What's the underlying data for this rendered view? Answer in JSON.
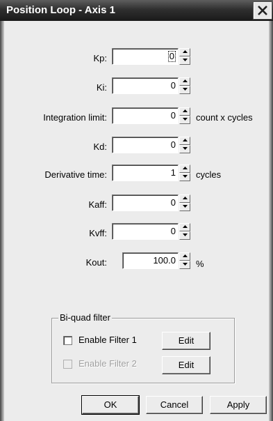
{
  "window": {
    "title": "Position Loop - Axis 1"
  },
  "fields": [
    {
      "label": "Kp:",
      "value": "0",
      "unit": ""
    },
    {
      "label": "Ki:",
      "value": "0",
      "unit": ""
    },
    {
      "label": "Integration limit:",
      "value": "0",
      "unit": "count x cycles"
    },
    {
      "label": "Kd:",
      "value": "0",
      "unit": ""
    },
    {
      "label": "Derivative time:",
      "value": "1",
      "unit": "cycles"
    },
    {
      "label": "Kaff:",
      "value": "0",
      "unit": ""
    },
    {
      "label": "Kvff:",
      "value": "0",
      "unit": ""
    },
    {
      "label": "Kout:",
      "value": "100.0",
      "unit": "%"
    }
  ],
  "filter_group": {
    "title": "Bi-quad filter",
    "filter1": {
      "label": "Enable Filter 1",
      "checked": false,
      "enabled": true,
      "edit_label": "Edit"
    },
    "filter2": {
      "label": "Enable Filter 2",
      "checked": false,
      "enabled": false,
      "edit_label": "Edit"
    }
  },
  "buttons": {
    "ok": "OK",
    "cancel": "Cancel",
    "apply": "Apply"
  }
}
